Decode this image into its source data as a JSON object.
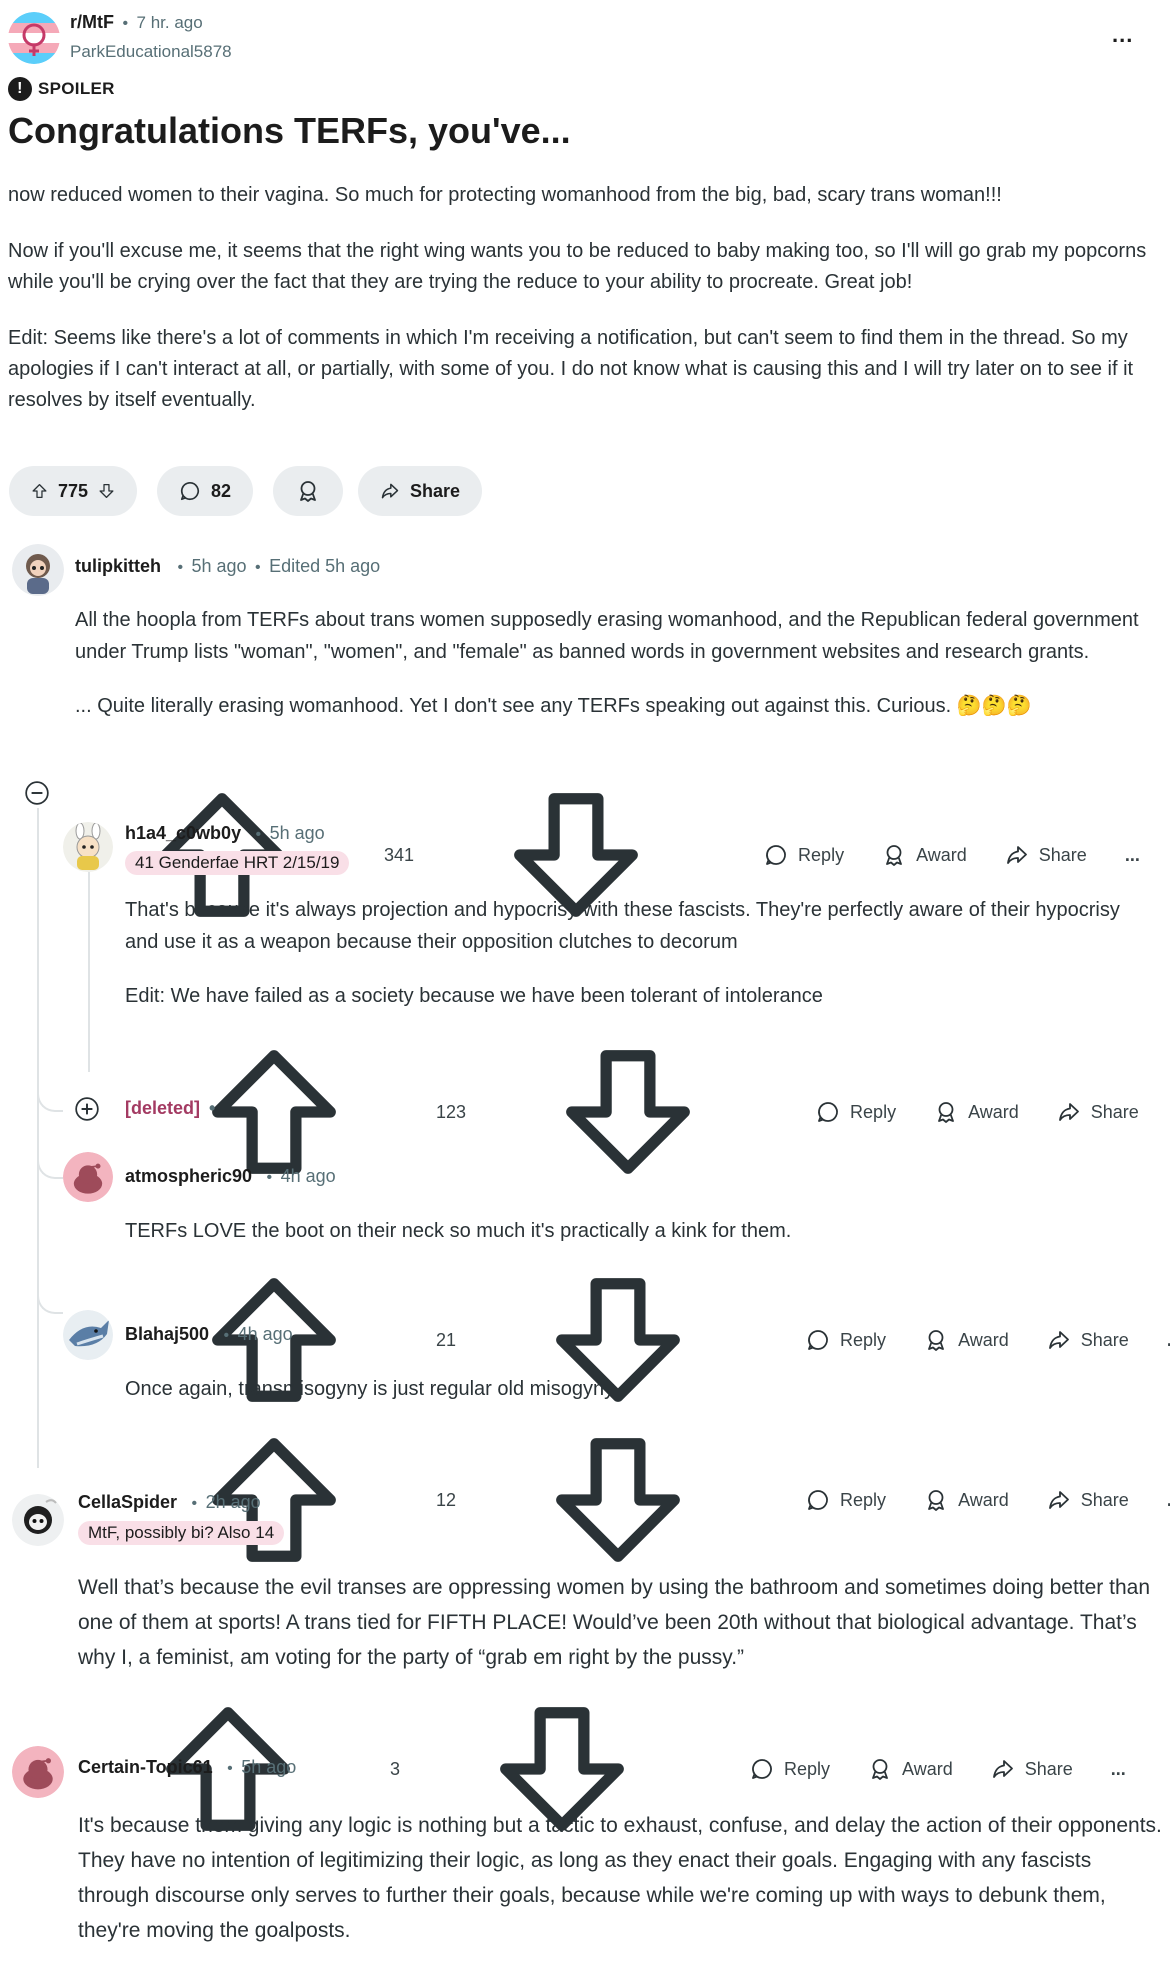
{
  "post": {
    "subreddit": "r/MtF",
    "time": "7 hr. ago",
    "author": "ParkEducational5878",
    "spoiler": "SPOILER",
    "title": "Congratulations TERFs, you've...",
    "paragraphs": [
      "now reduced women to their vagina. So much for protecting womanhood from the big, bad, scary trans woman!!!",
      "Now if you'll excuse me, it seems that the right wing wants you to be reduced to baby making too, so I'll will go grab my popcorns while you'll be crying over the fact that they are trying the reduce to your ability to procreate. Great job!",
      "Edit: Seems like there's a lot of comments in which I'm receiving a notification, but can't seem to find them in the thread. So my apologies if I can't interact at all, or partially, with some of you. I do not know what is causing this and I will try later on to see if it resolves by itself eventually."
    ],
    "upvotes": "775",
    "comments": "82",
    "share": "Share",
    "more": "..."
  },
  "labels": {
    "reply": "Reply",
    "award": "Award",
    "share": "Share",
    "more": "..."
  },
  "comments": [
    {
      "user": "tulipkitteh",
      "time": "5h ago",
      "edited": "Edited 5h ago",
      "paragraphs": [
        "All the hoopla from TERFs about trans women supposedly erasing womanhood, and the Republican federal government under Trump lists \"woman\", \"women\", and \"female\" as banned words in government websites and research grants.",
        "... Quite literally erasing womanhood. Yet I don't see any TERFs speaking out against this. Curious. 🤔🤔🤔"
      ],
      "votes": "341"
    },
    {
      "user": "h1a4_c0wb0y",
      "time": "5h ago",
      "flair": "41 Genderfae HRT 2/15/19",
      "paragraphs": [
        "That's because it's always projection and hypocrisy with these fascists. They're perfectly aware of their hypocrisy and use it as a weapon because their opposition clutches to decorum",
        "Edit: We have failed as a society because we have been tolerant of intolerance"
      ],
      "votes": "123"
    },
    {
      "user": "[deleted]"
    },
    {
      "user": "atmospheric90",
      "time": "4h ago",
      "paragraphs": [
        "TERFs LOVE the boot on their neck so much it's practically a kink for them."
      ],
      "votes": "21"
    },
    {
      "user": "Blahaj500",
      "time": "4h ago",
      "paragraphs": [
        "Once again, transmisogyny is just regular old misogyny."
      ],
      "votes": "12"
    },
    {
      "user": "CellaSpider",
      "time": "2h ago",
      "flair": "MtF, possibly bi? Also 14",
      "paragraphs": [
        "Well that’s because the evil transes are oppressing women by using the bathroom and sometimes doing better than one of them at sports! A trans tied for FIFTH PLACE! Would’ve been 20th without that biological advantage. That’s why I, a feminist, am voting for the party of “grab em right by the pussy.”"
      ],
      "votes": "3"
    },
    {
      "user": "Certain-Topic61",
      "time": "5h ago",
      "paragraphs": [
        "It's because them giving any logic is nothing but a tactic to exhaust, confuse, and delay the action of their opponents. They have no intention of legitimizing their logic, as long as they enact their goals. Engaging with any fascists through discourse only serves to further their goals, because while we're coming up with ways to debunk them, they're moving the goalposts."
      ]
    }
  ],
  "colors": {
    "flair_bg": "#f9dfe7",
    "deleted": "#a33a62",
    "pill_bg": "#eaedef"
  }
}
